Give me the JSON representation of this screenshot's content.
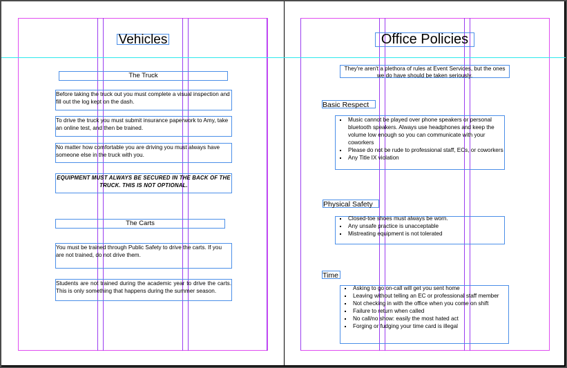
{
  "spread": {
    "left_page": {
      "title": "Vehicles",
      "sections": [
        {
          "heading": "The Truck",
          "paragraphs": [
            "Before taking the truck out you must complete a visual inspection and fill out the log kept on the dash.",
            "To drive the truck you must submit insurance paperwork to Amy, take an online test, and then be trained.",
            "No matter how comfortable you are driving you must always have someone else in the truck with you.",
            "EQUIPMENT MUST ALWAYS BE SECURED IN THE BACK OF THE TRUCK. THIS IS NOT OPTIONAL."
          ]
        },
        {
          "heading": "The Carts",
          "paragraphs": [
            "You must be trained through Public Safety to drive the carts. If you are not trained, do not drive them.",
            "Students are not trained during the academic year to drive the carts. This is only something that happens during the summer season."
          ]
        }
      ]
    },
    "right_page": {
      "title": "Office Policies",
      "intro": "They're aren't a plethora of rules at Event Services, but the ones we do have should be taken seriously.",
      "sections": [
        {
          "heading": "Basic Respect",
          "items": [
            "Music cannot be played over phone speakers or personal bluetooth speakers. Always use headphones and keep the volume low enough so you can communicate with your coworkers",
            "Please do not be rude to professional staff, ECs, or coworkers",
            "Any Title IX violation"
          ]
        },
        {
          "heading": "Physical Safety",
          "items": [
            "Closed-toe shoes must always be worn.",
            "Any unsafe practice is unacceptable",
            "Mistreating equipment is not tolerated"
          ]
        },
        {
          "heading": "Time",
          "items": [
            "Asking to go on-call will get you sent home",
            "Leaving without telling an EC or professional staff member",
            "Not checking in with the office when you come on shift",
            "Failure to return when called",
            "No call/no show: easily the most hated act",
            "Forging or fudging your time card is illegal"
          ]
        }
      ]
    }
  },
  "colors": {
    "margin_guide": "#e04cf0",
    "column_guide": "#9a3cf0",
    "ruler_guide": "#2ce8ec",
    "text_frame": "#4a8ee8",
    "pasteboard": "#4a4a4a"
  }
}
